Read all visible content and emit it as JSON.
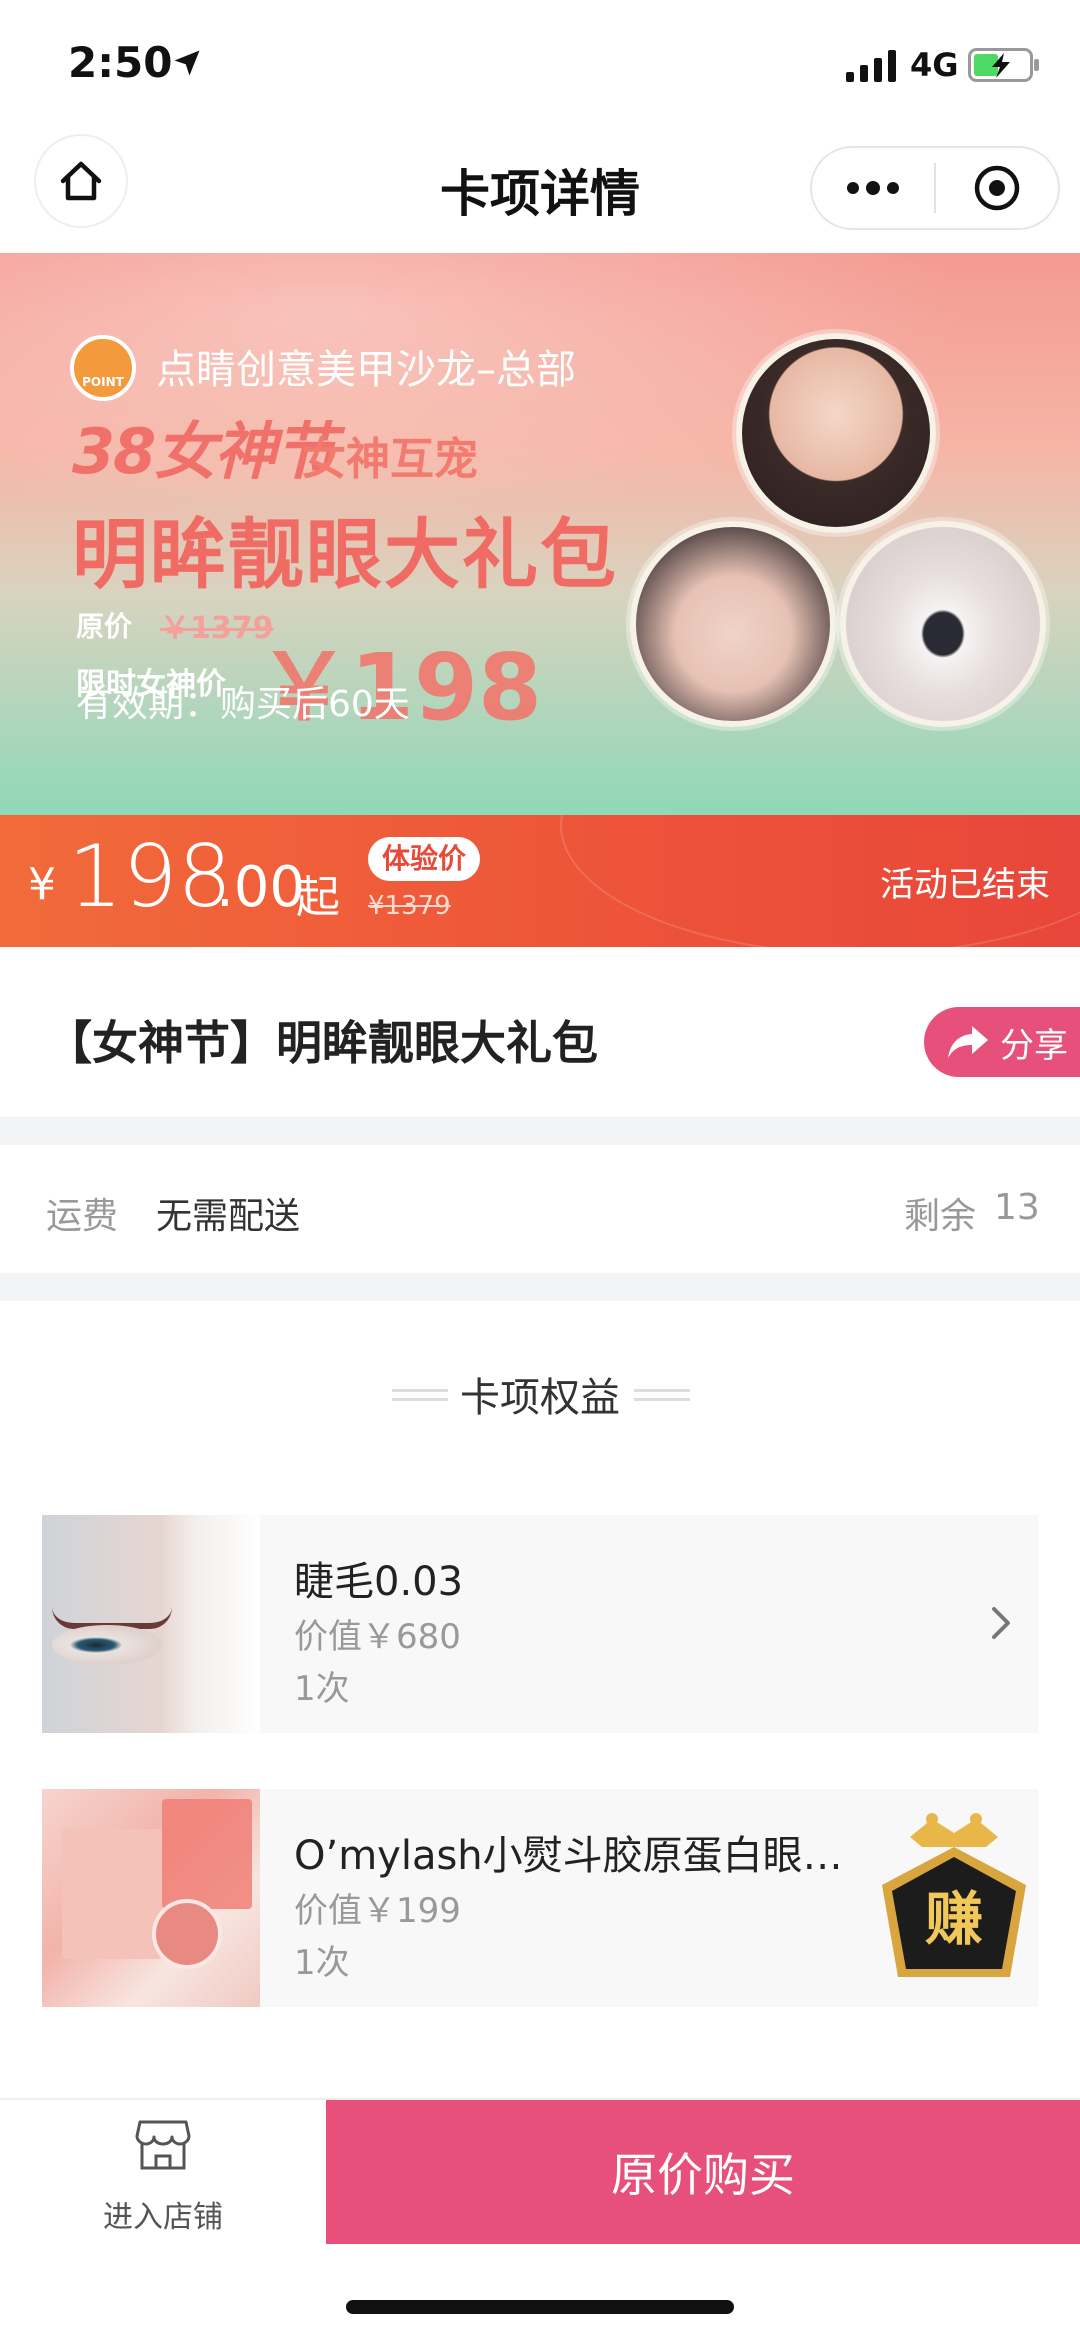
{
  "status_bar": {
    "time": "2:50",
    "network": "4G"
  },
  "nav": {
    "title": "卡项详情"
  },
  "banner": {
    "shop_name": "点睛创意美甲沙龙–总部",
    "logo_text": "POINT",
    "art_38": "38女神节",
    "art_tag": "女神互宠",
    "art_main": "明眸靓眼大礼包",
    "art_orig_label": "原价",
    "art_orig_price": "￥1379",
    "art_limit_label": "限时女神价",
    "art_limit_price": "￥198",
    "validity": "有效期：购买后60天"
  },
  "price": {
    "currency": "¥",
    "integer": "198",
    "decimal": ".00",
    "suffix": "起",
    "badge": "体验价",
    "original": "¥1379",
    "status": "活动已结束"
  },
  "product": {
    "title": "【女神节】明眸靓眼大礼包",
    "share_label": "分享"
  },
  "freight": {
    "label": "运费",
    "value": "无需配送",
    "stock_label": "剩余",
    "stock_value": "13"
  },
  "benefits": {
    "title": "卡项权益",
    "items": [
      {
        "name": "睫毛0.03",
        "value": "价值￥680",
        "count": "1次"
      },
      {
        "name": "O’mylash小熨斗胶原蛋白眼膜…",
        "value": "价值￥199",
        "count": "1次",
        "badge": "赚"
      }
    ]
  },
  "bottom": {
    "store_label": "进入店铺",
    "buy_label": "原价购买"
  },
  "colors": {
    "accent_pink": "#e6507b",
    "price_red": "#ef5a3a",
    "share_pink": "#e7507a"
  }
}
